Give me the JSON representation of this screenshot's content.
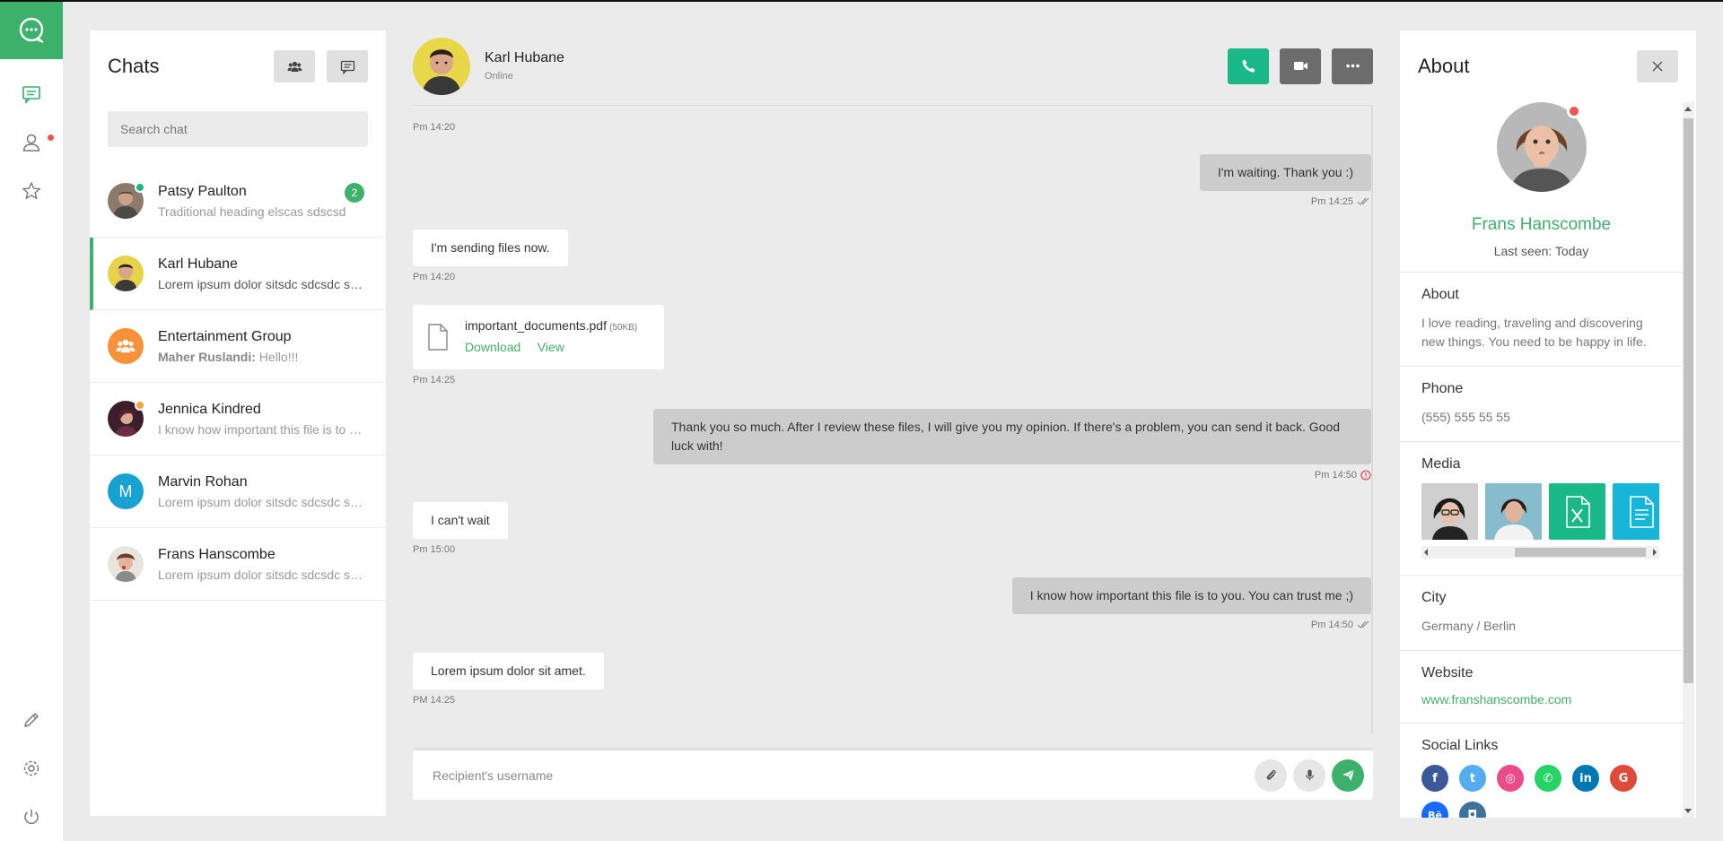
{
  "rail": {
    "accent": "#3db16b",
    "icons": [
      "chat-logo-icon",
      "chats-icon",
      "friends-icon",
      "favorites-icon",
      "edit-icon",
      "settings-icon",
      "power-icon"
    ]
  },
  "chats": {
    "title": "Chats",
    "search_placeholder": "Search chat",
    "items": [
      {
        "name": "Patsy Paulton",
        "preview": "Traditional heading elscas sdscsd",
        "unread": "2",
        "status": "online"
      },
      {
        "name": "Karl Hubane",
        "preview": "Lorem ipsum dolor sitsdc sdcsdc sdcsdc",
        "active": true
      },
      {
        "name": "Entertainment Group",
        "preview_sender": "Maher Ruslandi:",
        "preview": " Hello!!!"
      },
      {
        "name": "Jennica Kindred",
        "preview": "I know how important this file is to you",
        "status": "away"
      },
      {
        "name": "Marvin Rohan",
        "preview": "Lorem ipsum dolor sitsdc sdcsdc sdcsdc",
        "initial": "M"
      },
      {
        "name": "Frans Hanscombe",
        "preview": "Lorem ipsum dolor sitsdc sdcsdc sdcsdc"
      }
    ]
  },
  "conversation": {
    "name": "Karl Hubane",
    "status": "Online",
    "messages": [
      {
        "side": "in",
        "text": "",
        "time": "Pm 14:20"
      },
      {
        "side": "out",
        "text": "I'm waiting. Thank you :)",
        "time": "Pm 14:25"
      },
      {
        "side": "in",
        "text": "I'm sending files now.",
        "time": "Pm 14:20"
      },
      {
        "side": "in",
        "type": "file",
        "file_name": "important_documents.pdf",
        "file_size": "(50KB)",
        "download_label": "Download",
        "view_label": "View",
        "time": "Pm 14:25"
      },
      {
        "side": "out",
        "text": "Thank you so much. After I review these files, I will give you my opinion. If there's a problem, you can send it back. Good luck with!",
        "time": "Pm 14:50"
      },
      {
        "side": "in",
        "text": "I can't wait",
        "time": "Pm 15:00"
      },
      {
        "side": "out",
        "text": "I know how important this file is to you. You can trust me ;)",
        "time": "Pm 14:50"
      },
      {
        "side": "in",
        "text": "Lorem ipsum dolor sit amet.",
        "time": "PM 14:25"
      }
    ],
    "composer_placeholder": "Recipient's username"
  },
  "about": {
    "title": "About",
    "name": "Frans Hanscombe",
    "last_seen": "Last seen: Today",
    "about_title": "About",
    "about_text": "I love reading, traveling and discovering new things. You need to be happy in life.",
    "phone_title": "Phone",
    "phone": "(555) 555 55 55",
    "media_title": "Media",
    "city_title": "City",
    "city": "Germany / Berlin",
    "website_title": "Website",
    "website": "www.franshanscombe.com",
    "social_title": "Social Links",
    "social": [
      {
        "icon": "facebook-icon",
        "glyph": "f",
        "color": "#3b5998"
      },
      {
        "icon": "twitter-icon",
        "glyph": "t",
        "color": "#55acee"
      },
      {
        "icon": "dribbble-icon",
        "glyph": "◎",
        "color": "#ea4c89"
      },
      {
        "icon": "whatsapp-icon",
        "glyph": "✆",
        "color": "#25d366"
      },
      {
        "icon": "linkedin-icon",
        "glyph": "in",
        "color": "#0077b5"
      },
      {
        "icon": "google-icon",
        "glyph": "G",
        "color": "#dd4b39"
      },
      {
        "icon": "behance-icon",
        "glyph": "Bē",
        "color": "#1769ff"
      },
      {
        "icon": "instagram-icon",
        "glyph": "◘",
        "color": "#3f729b"
      }
    ]
  }
}
